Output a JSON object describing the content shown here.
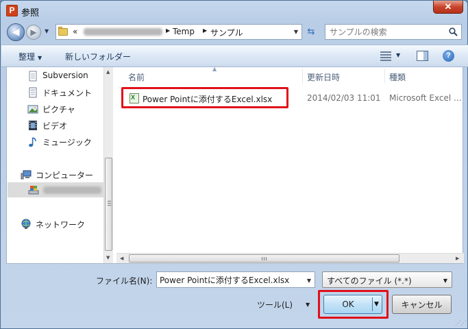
{
  "window": {
    "title": "参照",
    "app_icon_letter": "P",
    "close_glyph": "✕"
  },
  "address_bar": {
    "overflow": "«",
    "crumbs": [
      "Temp",
      "サンプル"
    ]
  },
  "search": {
    "placeholder": "サンプルの検索"
  },
  "toolbar": {
    "organize_label": "整理",
    "new_folder_label": "新しいフォルダー",
    "help_label": "?"
  },
  "nav_pane": {
    "items": [
      {
        "label": "Subversion",
        "icon": "document-icon"
      },
      {
        "label": "ドキュメント",
        "icon": "documents-icon"
      },
      {
        "label": "ピクチャ",
        "icon": "pictures-icon"
      },
      {
        "label": "ビデオ",
        "icon": "video-icon"
      },
      {
        "label": "ミュージック",
        "icon": "music-icon"
      },
      {
        "label": "コンピューター",
        "icon": "computer-icon"
      },
      {
        "label": "ネットワーク",
        "icon": "network-icon"
      }
    ]
  },
  "file_list": {
    "columns": [
      "名前",
      "更新日時",
      "種類"
    ],
    "rows": [
      {
        "name": "Power Pointに添付するExcel.xlsx",
        "modified": "2014/02/03 11:01",
        "type": "Microsoft Excel ...",
        "icon": "excel-file-icon"
      }
    ]
  },
  "bottom": {
    "filename_label": "ファイル名(N):",
    "filename_value": "Power Pointに添付するExcel.xlsx",
    "filter_value": "すべてのファイル (*.*)",
    "tools_label": "ツール(L)",
    "ok_label": "OK",
    "cancel_label": "キャンセル"
  },
  "colors": {
    "highlight_red": "#e0101a",
    "ok_blue": "#c2e2f7"
  }
}
